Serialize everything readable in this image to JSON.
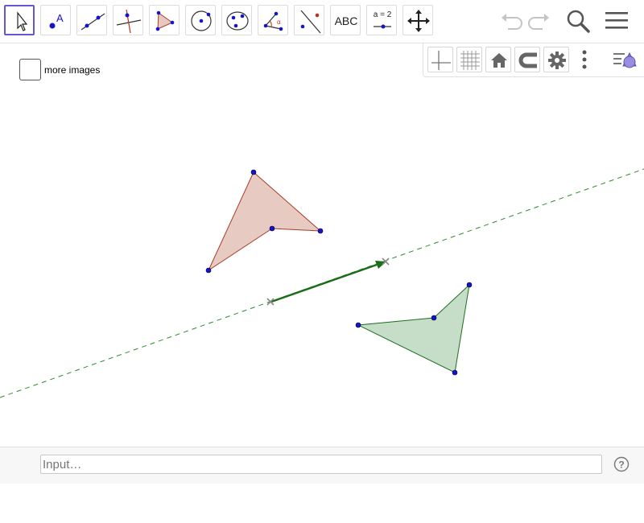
{
  "toolbar": {
    "tools": [
      {
        "name": "move-tool",
        "icon": "arrow-cursor-icon",
        "selected": true
      },
      {
        "name": "point-tool",
        "icon": "point-A-icon"
      },
      {
        "name": "line-tool",
        "icon": "line-through-points-icon"
      },
      {
        "name": "perpendicular-line-tool",
        "icon": "perpendicular-line-icon"
      },
      {
        "name": "polygon-tool",
        "icon": "polygon-icon"
      },
      {
        "name": "circle-tool",
        "icon": "circle-center-point-icon"
      },
      {
        "name": "ellipse-tool",
        "icon": "conic-through-points-icon"
      },
      {
        "name": "angle-tool",
        "icon": "angle-icon"
      },
      {
        "name": "reflect-tool",
        "icon": "reflect-about-line-icon"
      },
      {
        "name": "text-tool",
        "label": "ABC"
      },
      {
        "name": "slider-tool",
        "label": "a = 2"
      },
      {
        "name": "move-graphics-view-tool",
        "icon": "move-arrows-icon"
      }
    ],
    "undo_icon": "undo-icon",
    "redo_icon": "redo-icon",
    "search_icon": "search-icon",
    "menu_icon": "hamburger-menu-icon"
  },
  "stylebar": {
    "buttons": [
      "axes-icon",
      "grid-icon",
      "home-icon",
      "magnet-icon",
      "gear-icon",
      "more-vertical-icon",
      "view-toggle-icon"
    ]
  },
  "checkbox": {
    "label": "more images",
    "checked": false
  },
  "canvas": {
    "colors": {
      "original_fill": "#e6c8c0",
      "original_stroke": "#a83c26",
      "image_fill": "#c3dcc4",
      "image_stroke": "#1e6e1e",
      "vector": "#1a6e1a",
      "mirror_line": "#2e8b2e",
      "point": "#1515c8"
    }
  },
  "inputbar": {
    "placeholder": "Input…",
    "help_icon": "help-icon"
  }
}
